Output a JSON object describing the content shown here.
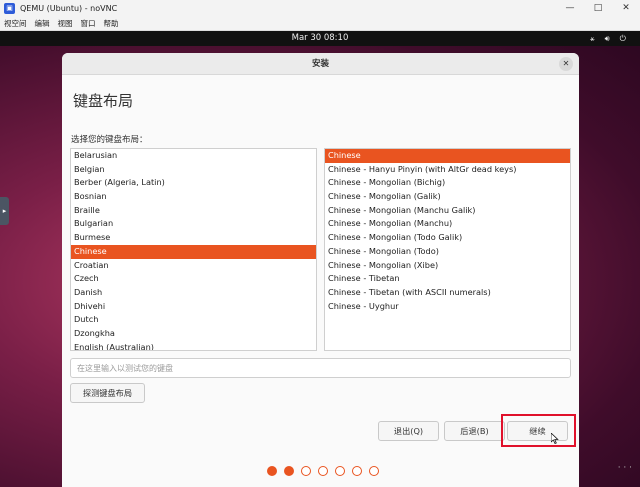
{
  "window": {
    "title": "QEMU (Ubuntu) - noVNC",
    "menu": [
      "视空间",
      "编辑",
      "视图",
      "窗口",
      "帮助"
    ],
    "controls": {
      "minimize": "—",
      "maximize": "□",
      "close": "✕"
    }
  },
  "topbar": {
    "clock": "Mar 30  08:10"
  },
  "dialog": {
    "title": "安装",
    "heading": "键盘布局",
    "prompt": "选择您的键盘布局：",
    "languages": [
      "Belarusian",
      "Belgian",
      "Berber (Algeria, Latin)",
      "Bosnian",
      "Braille",
      "Bulgarian",
      "Burmese",
      "Chinese",
      "Croatian",
      "Czech",
      "Danish",
      "Dhivehi",
      "Dutch",
      "Dzongkha",
      "English (Australian)"
    ],
    "selected_language": "Chinese",
    "variants": [
      "Chinese",
      "Chinese - Hanyu Pinyin (with AltGr dead keys)",
      "Chinese - Mongolian (Bichig)",
      "Chinese - Mongolian (Galik)",
      "Chinese - Mongolian (Manchu Galik)",
      "Chinese - Mongolian (Manchu)",
      "Chinese - Mongolian (Todo Galik)",
      "Chinese - Mongolian (Todo)",
      "Chinese - Mongolian (Xibe)",
      "Chinese - Tibetan",
      "Chinese - Tibetan (with ASCII numerals)",
      "Chinese - Uyghur"
    ],
    "selected_variant": "Chinese",
    "test_placeholder": "在这里输入以测试您的键盘",
    "detect_button": "探测键盘布局",
    "quit_button": "退出(Q)",
    "back_button": "后退(B)",
    "continue_button": "继续",
    "progress": {
      "total": 7,
      "done": 2
    }
  },
  "colors": {
    "accent": "#e95420",
    "highlight": "#e0112b"
  }
}
